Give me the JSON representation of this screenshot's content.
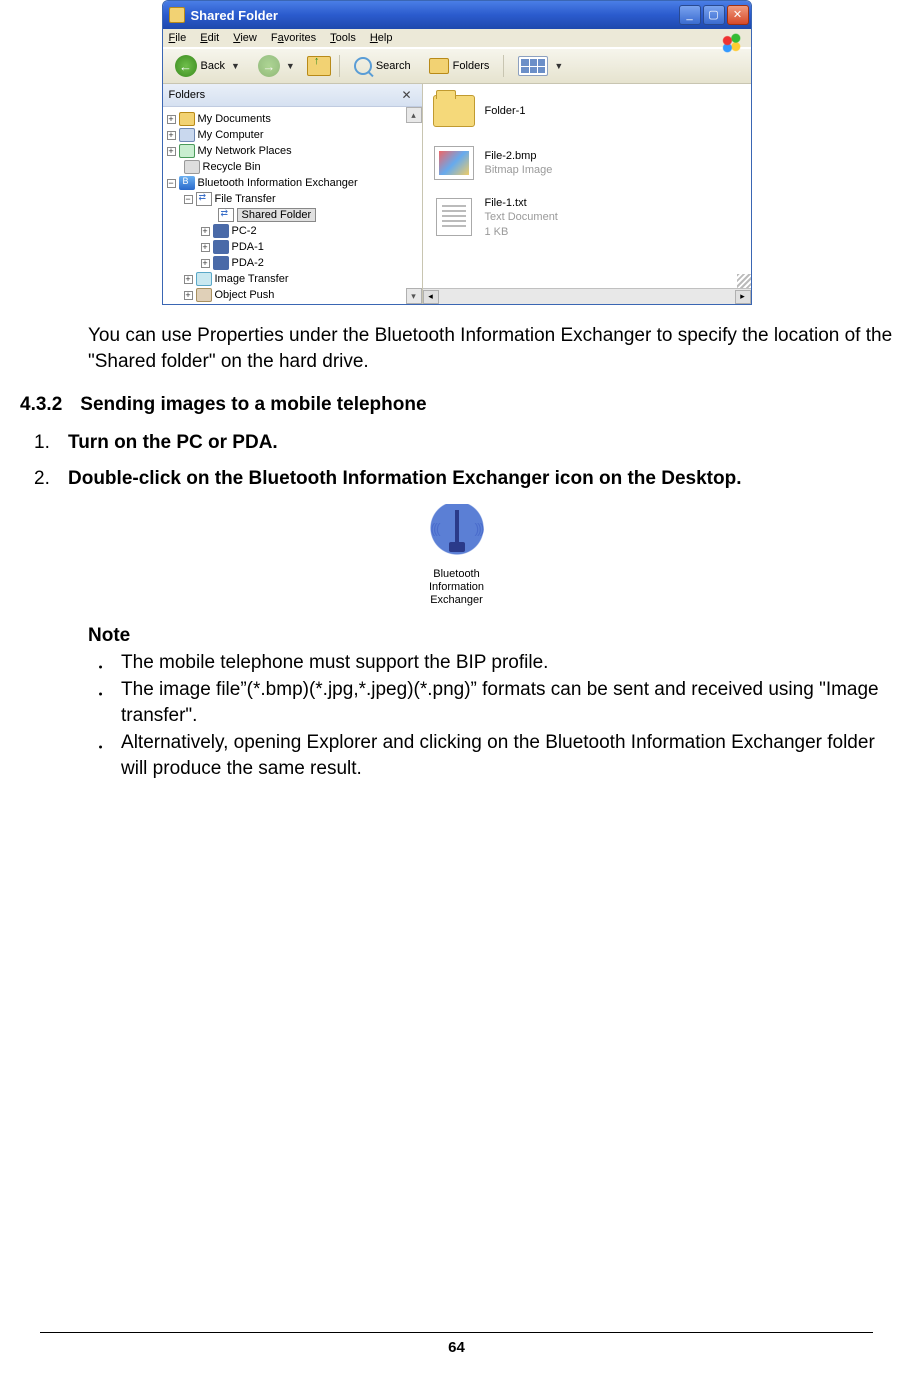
{
  "xp": {
    "title": "Shared Folder",
    "menubar": [
      "File",
      "Edit",
      "View",
      "Favorites",
      "Tools",
      "Help"
    ],
    "toolbar": {
      "back": "Back",
      "search": "Search",
      "folders": "Folders"
    },
    "folders_pane": {
      "header": "Folders",
      "tree": {
        "my_documents": "My Documents",
        "my_computer": "My Computer",
        "my_network": "My Network Places",
        "recycle_bin": "Recycle Bin",
        "bt_exchanger": "Bluetooth Information Exchanger",
        "file_transfer": "File Transfer",
        "shared_folder": "Shared Folder",
        "pc2": "PC-2",
        "pda1": "PDA-1",
        "pda2": "PDA-2",
        "image_transfer": "Image Transfer",
        "object_push": "Object Push"
      }
    },
    "content": {
      "folder1": {
        "name": "Folder-1"
      },
      "file2": {
        "name": "File-2.bmp",
        "type": "Bitmap Image"
      },
      "file1": {
        "name": "File-1.txt",
        "type": "Text Document",
        "size": "1 KB"
      }
    }
  },
  "body": {
    "para1": "You can use Properties under the Bluetooth Information Exchanger to specify the location of the \"Shared folder\" on the hard drive.",
    "section_num": "4.3.2",
    "section_title": "Sending images to a mobile telephone",
    "steps": [
      {
        "num": "1.",
        "text": "Turn on the PC or PDA."
      },
      {
        "num": "2.",
        "text": "Double-click on the Bluetooth Information Exchanger icon on the Desktop."
      }
    ],
    "icon_caption_l1": "Bluetooth",
    "icon_caption_l2": "Information",
    "icon_caption_l3": "Exchanger",
    "note_label": "Note",
    "notes": [
      "The mobile telephone must support the BIP profile.",
      "The image file”(*.bmp)(*.jpg,*.jpeg)(*.png)” formats can be sent and received using \"Image transfer\".",
      "Alternatively, opening Explorer and clicking on the Bluetooth Information Exchanger folder will produce the same result."
    ],
    "page_number": "64"
  }
}
